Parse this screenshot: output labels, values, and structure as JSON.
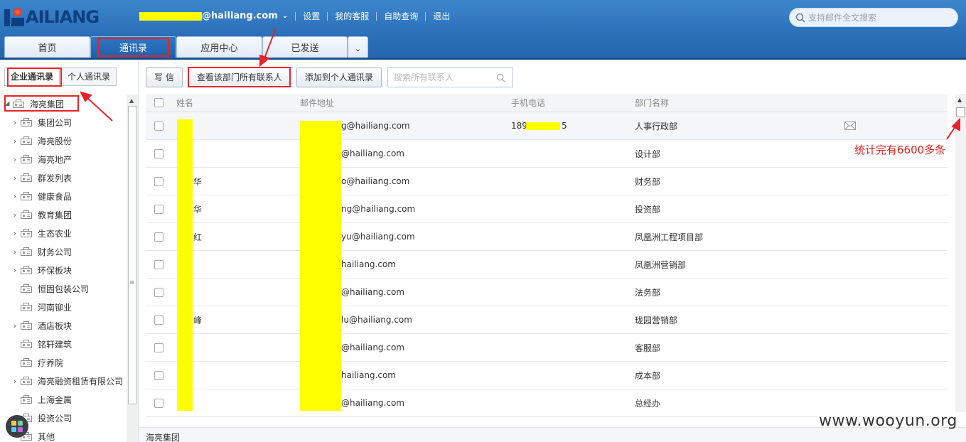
{
  "header": {
    "logo_text": "AILIANG",
    "email_domain": "@hailiang.com",
    "nav": [
      "设置",
      "我的客服",
      "自助查询",
      "退出"
    ],
    "search_placeholder": "支持邮件全文搜索"
  },
  "tabs": [
    {
      "label": "首页"
    },
    {
      "label": "通讯录"
    },
    {
      "label": "应用中心"
    },
    {
      "label": "已发送"
    }
  ],
  "left": {
    "tabs": [
      "企业通讯录",
      "个人通讯录"
    ],
    "root": "海亮集团",
    "items": [
      {
        "label": "集团公司",
        "expandable": true
      },
      {
        "label": "海亮股份",
        "expandable": true
      },
      {
        "label": "海亮地产",
        "expandable": true
      },
      {
        "label": "群发列表",
        "expandable": true
      },
      {
        "label": "健康食品",
        "expandable": true
      },
      {
        "label": "教育集团",
        "expandable": true
      },
      {
        "label": "生态农业",
        "expandable": true
      },
      {
        "label": "财务公司",
        "expandable": true
      },
      {
        "label": "环保板块",
        "expandable": true
      },
      {
        "label": "恒固包装公司",
        "expandable": false
      },
      {
        "label": "河南铆业",
        "expandable": false
      },
      {
        "label": "酒店板块",
        "expandable": true
      },
      {
        "label": "铭轩建筑",
        "expandable": false
      },
      {
        "label": "疗养院",
        "expandable": false
      },
      {
        "label": "海亮融资租赁有限公司",
        "expandable": true
      },
      {
        "label": "上海金属",
        "expandable": false
      },
      {
        "label": "投资公司",
        "expandable": false
      },
      {
        "label": "其他",
        "expandable": false
      }
    ]
  },
  "toolbar": {
    "write": "写 信",
    "view_all": "查看该部门所有联系人",
    "add_personal": "添加到个人通讯录",
    "search_placeholder": "搜索所有联系人"
  },
  "grid": {
    "headers": [
      "姓名",
      "邮件地址",
      "手机电话",
      "部门名称"
    ],
    "rows": [
      {
        "name": "",
        "mail": "g@hailiang.com",
        "phone_prefix": "189",
        "phone_suffix": "5",
        "dept": "人事行政部"
      },
      {
        "name": "",
        "mail": "@hailiang.com",
        "phone_prefix": "",
        "phone_suffix": "",
        "dept": "设计部"
      },
      {
        "name": "华",
        "mail": "o@hailiang.com",
        "phone_prefix": "",
        "phone_suffix": "",
        "dept": "财务部"
      },
      {
        "name": "华",
        "mail": "ng@hailiang.com",
        "phone_prefix": "",
        "phone_suffix": "",
        "dept": "投资部"
      },
      {
        "name": "红",
        "mail": "yu@hailiang.com",
        "phone_prefix": "",
        "phone_suffix": "",
        "dept": "凤凰洲工程项目部"
      },
      {
        "name": "",
        "mail": "hailiang.com",
        "phone_prefix": "",
        "phone_suffix": "",
        "dept": "凤凰洲营销部"
      },
      {
        "name": "",
        "mail": "@hailiang.com",
        "phone_prefix": "",
        "phone_suffix": "",
        "dept": "法务部"
      },
      {
        "name": "峰",
        "mail": "lu@hailiang.com",
        "phone_prefix": "",
        "phone_suffix": "",
        "dept": "珑园营销部"
      },
      {
        "name": "",
        "mail": "@hailiang.com",
        "phone_prefix": "",
        "phone_suffix": "",
        "dept": "客服部"
      },
      {
        "name": "",
        "mail": "hailiang.com",
        "phone_prefix": "",
        "phone_suffix": "",
        "dept": "成本部"
      },
      {
        "name": "",
        "mail": "@hailiang.com",
        "phone_prefix": "",
        "phone_suffix": "",
        "dept": "总经办"
      }
    ]
  },
  "annotation": "统计完有6600多条",
  "status_bar": "海亮集团",
  "watermark": "www.wooyun.org",
  "colors": {
    "accent": "#2a6fb8",
    "highlight": "#e8232a",
    "redaction": "#ffff00"
  }
}
